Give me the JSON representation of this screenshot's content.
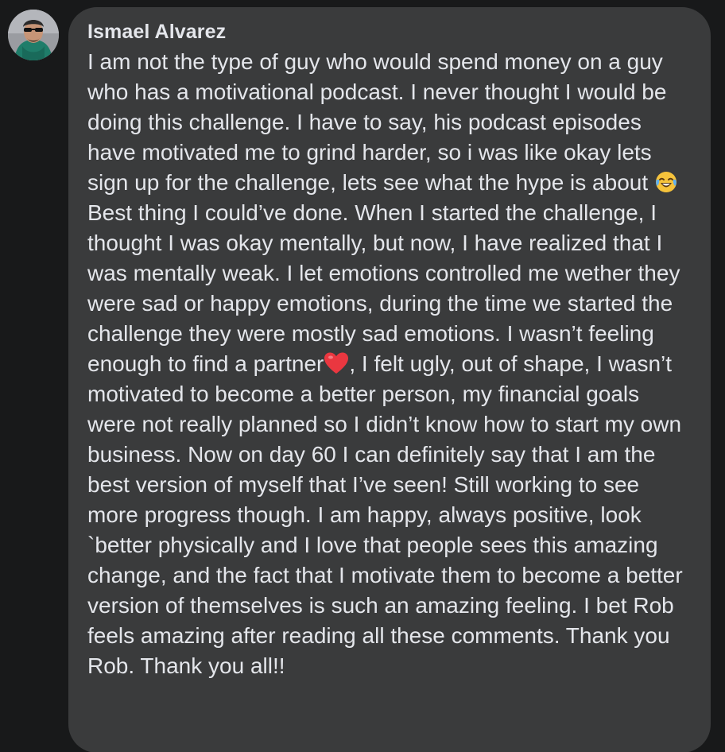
{
  "comment": {
    "author": "Ismael Alvarez",
    "text_parts": [
      "I am not the type of guy who would spend money on a guy who has a motivational podcast. I never thought I would be doing this challenge. I have to say, his podcast episodes have motivated me to grind harder, so i was like okay lets sign up for the challenge, lets see what the hype is about ",
      " Best thing I could’ve done. When I started the challenge, I thought I was okay mentally, but now, I have realized that I was mentally weak. I let emotions controlled me wether they were sad or happy emotions, during the time we started the challenge they were mostly sad emotions. I wasn’t feeling enough to find a partner",
      ", I felt ugly, out of shape, I wasn’t motivated to become a better person, my financial goals were not really planned so I didn’t know how to start my own business. Now on day 60 I can definitely say that I am the best version of myself that I’ve seen! Still working to see more progress though. I am happy, always positive, look `better physically and I love that people sees this amazing change, and the fact that I motivate them to become a better version of themselves is such an amazing feeling. I bet Rob feels amazing after reading all these comments. Thank you Rob. Thank you all!!"
    ],
    "emojis": [
      "laughing-tears-emoji",
      "red-heart-emoji"
    ]
  },
  "colors": {
    "background": "#18191a",
    "bubble": "#3a3b3c",
    "text": "#e4e6eb"
  }
}
